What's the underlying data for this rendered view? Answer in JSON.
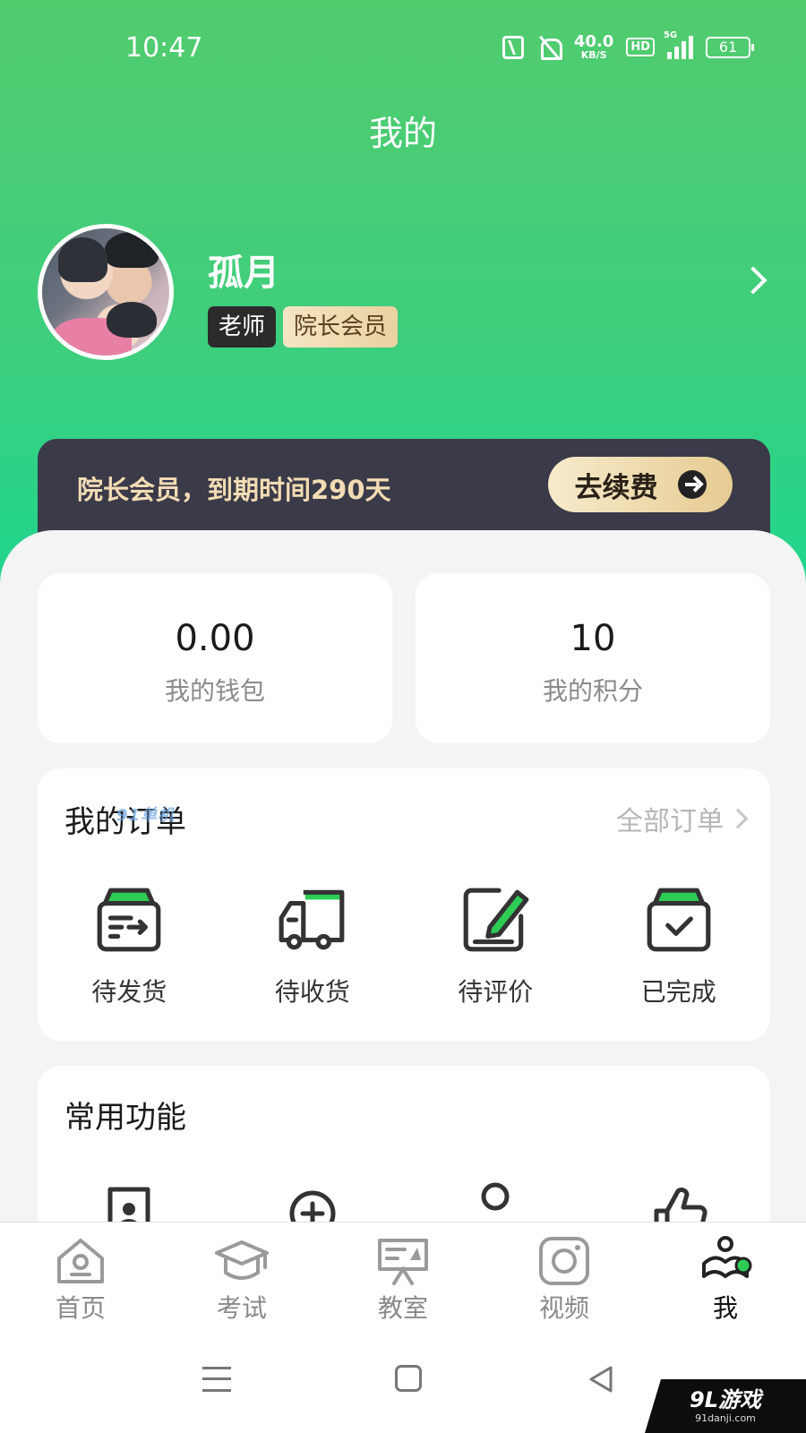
{
  "status_bar": {
    "time": "10:47",
    "net_speed": "40.0",
    "net_unit": "KB/S",
    "hd": "HD",
    "network": "5G",
    "battery": "61"
  },
  "header": {
    "title": "我的"
  },
  "profile": {
    "name": "孤月",
    "role_badge": "老师",
    "vip_badge": "院长会员"
  },
  "vip_bar": {
    "text": "院长会员，到期时间290天",
    "renew_label": "去续费"
  },
  "stats": {
    "wallet": {
      "value": "0.00",
      "label": "我的钱包"
    },
    "points": {
      "value": "10",
      "label": "我的积分"
    }
  },
  "orders": {
    "title": "我的订单",
    "all_label": "全部订单",
    "items": [
      {
        "label": "待发货",
        "icon": "box-ship-icon"
      },
      {
        "label": "待收货",
        "icon": "truck-icon"
      },
      {
        "label": "待评价",
        "icon": "edit-review-icon"
      },
      {
        "label": "已完成",
        "icon": "box-check-icon"
      }
    ]
  },
  "functions": {
    "title": "常用功能",
    "icons": [
      "id-card-icon",
      "plus-circle-icon",
      "circle-icon",
      "thumbs-up-icon"
    ]
  },
  "tabbar": {
    "items": [
      {
        "label": "首页",
        "icon": "home-icon",
        "active": false
      },
      {
        "label": "考试",
        "icon": "graduation-cap-icon",
        "active": false
      },
      {
        "label": "教室",
        "icon": "classroom-board-icon",
        "active": false
      },
      {
        "label": "视频",
        "icon": "video-camera-icon",
        "active": false
      },
      {
        "label": "我",
        "icon": "profile-icon",
        "active": true
      }
    ]
  },
  "watermark": {
    "title": "9L游戏",
    "url": "91danji.com",
    "overlay_text": "91单机"
  },
  "colors": {
    "header_green": "#52cb6e",
    "accent_green": "#1fd68e",
    "icon_green": "#2ecc55",
    "vip_bar_bg": "#3b3a48",
    "vip_gold": "#e6cb92"
  }
}
